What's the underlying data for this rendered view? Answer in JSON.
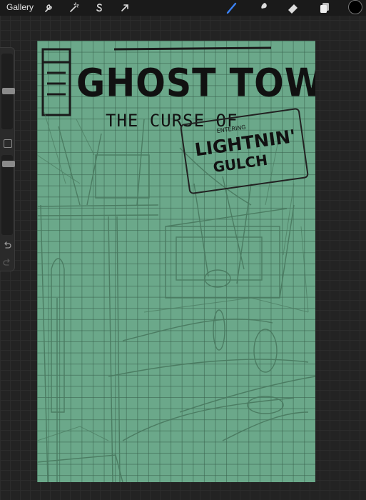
{
  "topbar": {
    "gallery_label": "Gallery",
    "actions_icon": "wrench-icon",
    "adjustments_icon": "magic-wand-icon",
    "selection_icon": "selection-s-icon",
    "transform_icon": "arrow-cursor-icon",
    "tools": [
      "brush-icon",
      "smudge-icon",
      "eraser-icon",
      "layers-icon"
    ],
    "active_tool": "brush-icon",
    "active_color": "#000000",
    "accent": "#3b82f6"
  },
  "sidebar": {
    "brush_size_level": 0.2,
    "opacity_level": 0.18,
    "undo_icon": "undo-icon",
    "redo_icon": "redo-icon"
  },
  "canvas": {
    "background": "#6ba88a",
    "title": "GHOST TOWN",
    "subtitle": "THE CURSE OF",
    "sign": {
      "small_text": "ENTERING",
      "big_text": "LIGHTNIN'",
      "town_text": "GULCH"
    }
  }
}
